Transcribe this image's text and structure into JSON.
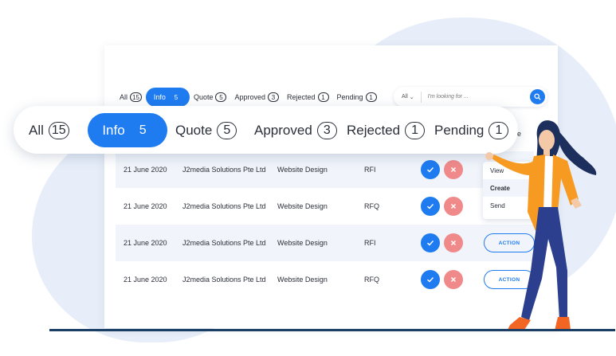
{
  "tabs": [
    {
      "label": "All",
      "count": "15"
    },
    {
      "label": "Info",
      "count": "5"
    },
    {
      "label": "Quote",
      "count": "5"
    },
    {
      "label": "Approved",
      "count": "3"
    },
    {
      "label": "Rejected",
      "count": "1"
    },
    {
      "label": "Pending",
      "count": "1"
    }
  ],
  "active_tab": "Info",
  "search": {
    "filter_label": "All",
    "placeholder": "I'm looking for ..."
  },
  "rows": [
    {
      "date": "21 June 2020",
      "company": "J2media Solutions Pte Ltd",
      "type": "Website Design",
      "code": "RFI"
    },
    {
      "date": "21 June 2020",
      "company": "J2media Solutions Pte Ltd",
      "type": "Website Design",
      "code": "RFQ"
    },
    {
      "date": "21 June 2020",
      "company": "J2media Solutions Pte Ltd",
      "type": "Website Design",
      "code": "RFI",
      "action": "ACTION"
    },
    {
      "date": "21 June 2020",
      "company": "J2media Solutions Pte Ltd",
      "type": "Website Design",
      "code": "RFQ",
      "action": "ACTION"
    }
  ],
  "menu": {
    "items": [
      "View",
      "Create",
      "Send"
    ],
    "highlighted": "Create"
  },
  "header_fragment": "e",
  "colors": {
    "accent": "#1e7bf0",
    "reject": "#f08a8a",
    "row_shade": "#f1f5fb",
    "floor": "#1b3f64"
  }
}
